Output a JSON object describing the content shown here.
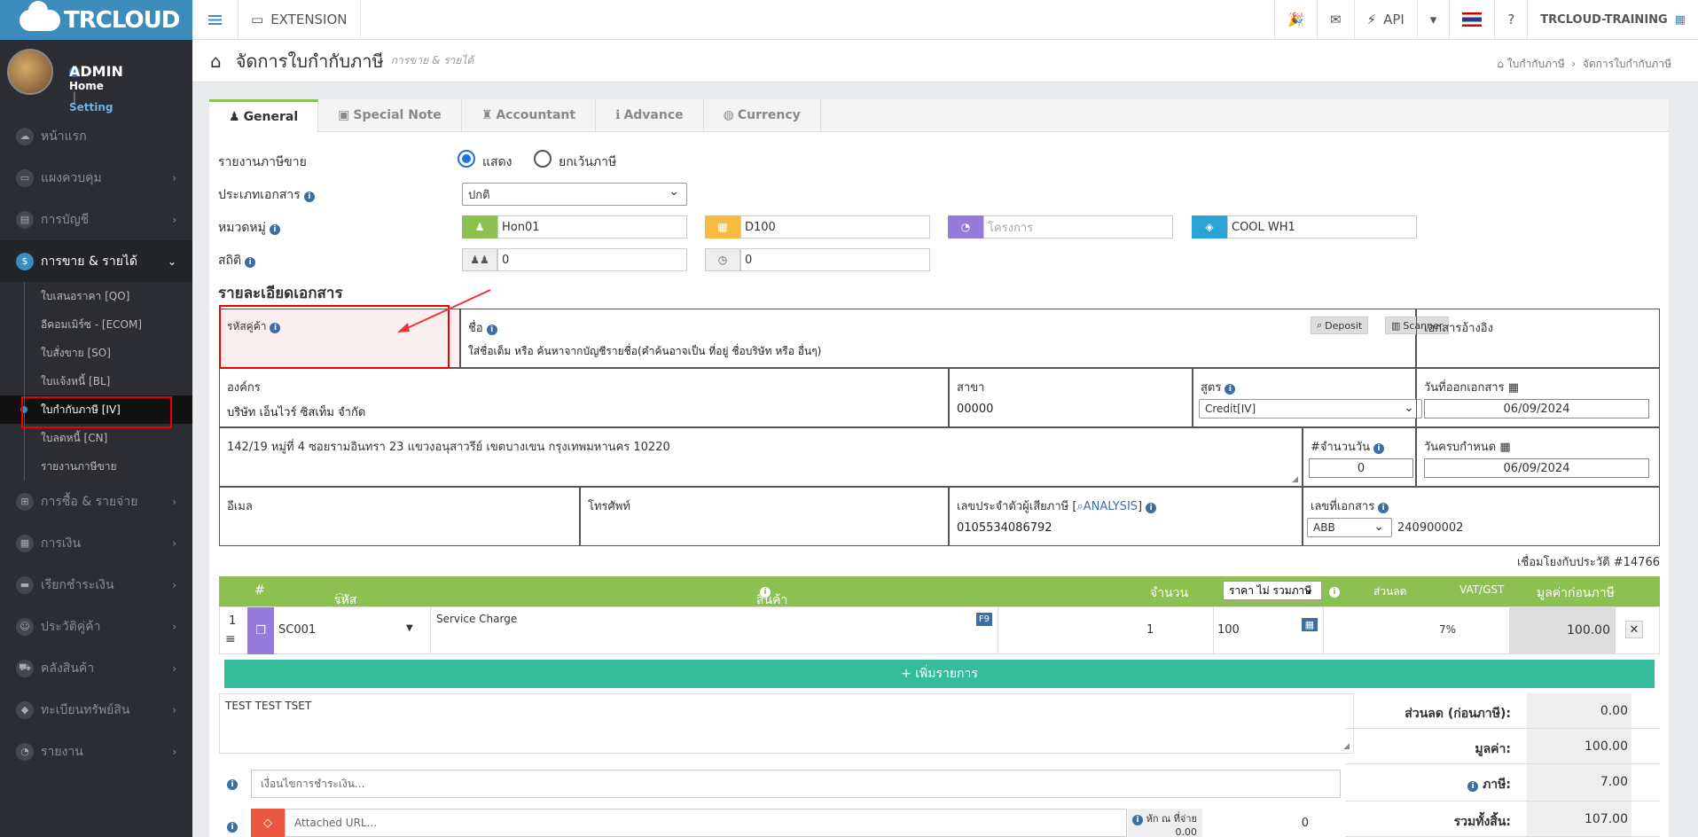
{
  "app": {
    "logo_text": "TRCLOUD"
  },
  "user": {
    "name": "ADMIN",
    "home": "Home",
    "sep": "|",
    "setting": "Setting"
  },
  "nav": [
    {
      "label": "หน้าแรก"
    },
    {
      "label": "แผงควบคุม"
    },
    {
      "label": "การบัญชี"
    },
    {
      "label": "การขาย & รายได้"
    },
    {
      "label": "การซื้อ & รายจ่าย"
    },
    {
      "label": "การเงิน"
    },
    {
      "label": "เรียกชำระเงิน"
    },
    {
      "label": "ประวัติคู่ค้า"
    },
    {
      "label": "คลังสินค้า"
    },
    {
      "label": "ทะเบียนทรัพย์สิน"
    },
    {
      "label": "รายงาน"
    }
  ],
  "subnav": [
    {
      "label": "ใบเสนอราคา [QO]"
    },
    {
      "label": "อีคอมเมิร์ซ - [ECOM]"
    },
    {
      "label": "ใบสั่งขาย [SO]"
    },
    {
      "label": "ใบแจ้งหนี้ [BL]"
    },
    {
      "label": "ใบกำกับภาษี [IV]"
    },
    {
      "label": "ใบลดหนี้ [CN]"
    },
    {
      "label": "รายงานภาษีขาย"
    }
  ],
  "topbar": {
    "extension": "EXTENSION",
    "api": "API",
    "company": "TRCLOUD-TRAINING"
  },
  "page": {
    "title": "จัดการใบกำกับภาษี",
    "subtitle": "การขาย & รายได้",
    "crumb1": "ใบกำกับภาษี",
    "crumb2": "จัดการใบกำกับภาษี"
  },
  "tabs": [
    "General",
    "Special Note",
    "Accountant",
    "Advance",
    "Currency"
  ],
  "form": {
    "tax_report_label": "รายงานภาษีขาย",
    "opt_show": "แสดง",
    "opt_exempt": "ยกเว้นภาษี",
    "doc_type_label": "ประเภทเอกสาร",
    "doc_type_value": "ปกติ",
    "category_label": "หมวดหมู่",
    "cat1": "Hon01",
    "cat2": "D100",
    "cat3_placeholder": "โครงการ",
    "cat4": "COOL WH1",
    "stat_label": "สถิติ",
    "stat1": "0",
    "stat2": "0"
  },
  "doc": {
    "section_title": "รายละเอียดเอกสาร",
    "customer_code_label": "รหัสคู่ค้า",
    "name_label": "ชื่อ",
    "name_hint": "ใส่ชื่อเต็ม หรือ ค้นหาจากบัญชีรายชื่อ(คำค้นอาจเป็น ที่อยู่ ชื่อบริษัท หรือ อื่นๆ)",
    "deposit": "Deposit",
    "scanner": "Scanner",
    "ref_label": "เอกสารอ้างอิง",
    "org_label": "องค์กร",
    "org_value": "บริษัท เอ็นไวร์ ซิสเท็ม จำกัด",
    "branch_label": "สาขา",
    "branch_value": "00000",
    "formula_label": "สูตร",
    "formula_value": "Credit[IV]",
    "issue_date_label": "วันที่ออกเอกสาร",
    "issue_date": "06/09/2024",
    "address": "142/19 หมู่ที่ 4 ซอยรามอินทรา 23 แขวงอนุสาวรีย์ เขตบางเขน กรุงเทพมหานคร 10220",
    "days_label": "#จำนวนวัน",
    "days": "0",
    "due_label": "วันครบกำหนด",
    "due_date": "06/09/2024",
    "email_label": "อีเมล",
    "phone_label": "โทรศัพท์",
    "taxid_label": "เลขประจำตัวผู้เสียภาษี [",
    "analysis": "ANALYSIS",
    "taxid_close": "]",
    "taxid": "0105534086792",
    "docno_label": "เลขที่เอกสาร",
    "docno_prefix": "ABB",
    "docno": "240900002",
    "history": "เชื่อมโยงกับประวัติ #14766"
  },
  "items": {
    "h_no": "#",
    "h_code": "รหัส",
    "h_product": "สินค้า",
    "h_qty": "จำนวน",
    "h_price": "ราคา ไม่ รวมภาษี",
    "h_disc": "ส่วนลด",
    "h_vat": "VAT/GST",
    "h_total": "มูลค่าก่อนภาษี",
    "row": {
      "no": "1",
      "code": "SC001",
      "product": "Service Charge",
      "f9": "F9",
      "qty": "1",
      "price": "100",
      "vat": "7%",
      "total": "100.00"
    },
    "add": "+ เพิ่มรายการ"
  },
  "note": "TEST TEST TSET",
  "payment_placeholder": "เงื่อนไขการชำระเงิน...",
  "url_placeholder": "Attached URL...",
  "wht_label": "หัก ณ ที่จ่าย",
  "wht_value": "0.00",
  "wht_amount": "0",
  "summary": {
    "discount_label": "ส่วนลด (ก่อนภาษี):",
    "discount": "0.00",
    "value_label": "มูลค่า:",
    "value": "100.00",
    "tax_label": "ภาษี:",
    "tax": "7.00",
    "total_label": "รวมทั้งสิ้น:",
    "total": "107.00"
  }
}
